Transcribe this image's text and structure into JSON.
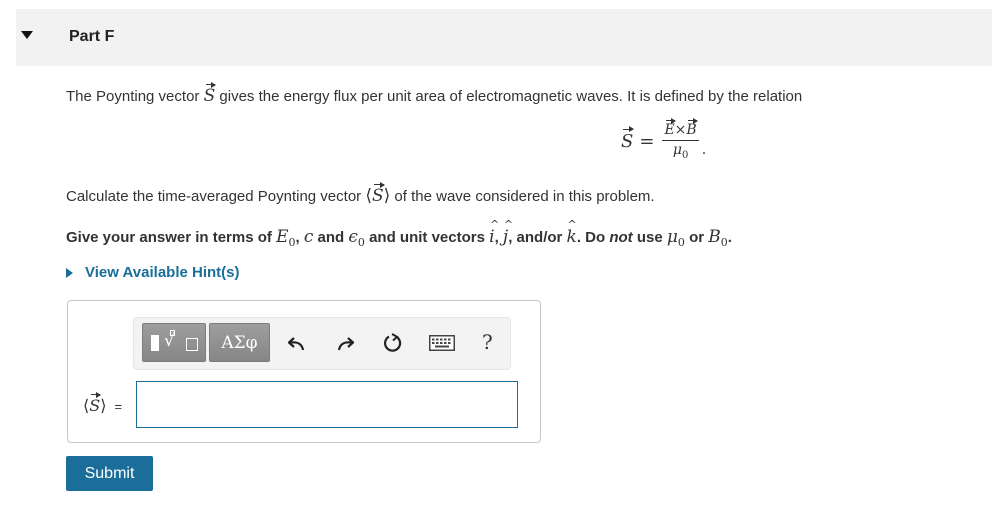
{
  "part": {
    "title": "Part F"
  },
  "intro": {
    "text_before": "The Poynting vector ",
    "symbol": "S",
    "text_after": " gives the energy flux per unit area of electromagnetic waves. It is defined by the relation"
  },
  "formula": {
    "lhs": "S",
    "equals": "=",
    "num_e": "E",
    "times": "×",
    "num_b": "B",
    "den": "μ",
    "den_sub": "0",
    "end": "."
  },
  "calc": {
    "text_before": "Calculate the time-averaged Poynting vector ",
    "symbol": "⟨S⟩",
    "text_after": " of the wave considered in this problem."
  },
  "give": {
    "t1": "Give your answer in terms of ",
    "e0": "E",
    "e0_sub": "0",
    "t2": ", ",
    "c": "c",
    "t3": " and ",
    "eps": "ϵ",
    "eps_sub": "0",
    "t4": " and unit vectors ",
    "i": "i",
    "t5": ", ",
    "j": "j",
    "t6": ", and/or ",
    "k": "k",
    "t7": ". Do ",
    "not": "not",
    "t8": " use ",
    "mu": "μ",
    "mu_sub": "0",
    "t9": " or ",
    "b": "B",
    "b_sub": "0",
    "t10": "."
  },
  "hint": {
    "label": "View Available Hint(s)"
  },
  "toolbar": {
    "templates_icon": "templates-icon",
    "symbols_label": "ΑΣφ",
    "undo_icon": "undo-icon",
    "redo_icon": "redo-icon",
    "reset_icon": "reset-icon",
    "keyboard_icon": "keyboard-icon",
    "help_label": "?"
  },
  "answer": {
    "label_open": "⟨",
    "label_symbol": "S",
    "label_close": "⟩",
    "label_equals": "=",
    "value": ""
  },
  "submit": {
    "label": "Submit"
  },
  "colors": {
    "accent": "#1a6e99",
    "header_bg": "#f2f2f2",
    "toolbar_btn": "#909090"
  }
}
